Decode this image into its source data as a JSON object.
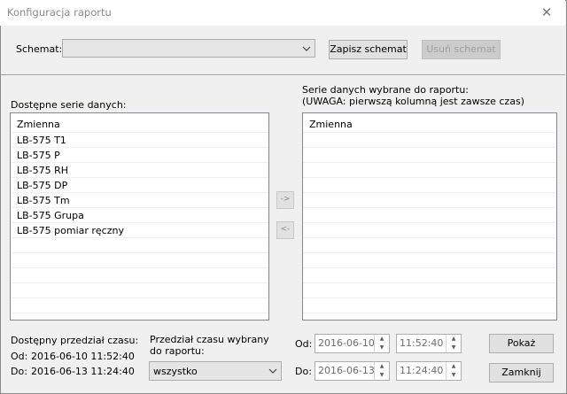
{
  "window": {
    "title": "Konfiguracja raportu"
  },
  "schema": {
    "label": "Schemat:",
    "value": "",
    "save_label": "Zapisz schemat",
    "delete_label": "Usuń schemat"
  },
  "available": {
    "title": "Dostępne serie danych:",
    "header": "Zmienna",
    "items": [
      "LB-575 T1",
      "LB-575 P",
      "LB-575 RH",
      "LB-575 DP",
      "LB-575 Tm",
      "LB-575 Grupa",
      "LB-575 pomiar ręczny"
    ]
  },
  "selected": {
    "title_line1": "Serie danych wybrane do raportu:",
    "title_line2": "(UWAGA: pierwszą kolumną jest zawsze czas)",
    "header": "Zmienna"
  },
  "transfer": {
    "add_label": "->",
    "remove_label": "<-"
  },
  "available_range": {
    "title": "Dostępny przedział czasu:",
    "from_label": "Od:",
    "from_value": "2016-06-10 11:52:40",
    "to_label": "Do:",
    "to_value": "2016-06-13 11:24:40"
  },
  "chosen_range": {
    "title_line1": "Przedział czasu wybrany",
    "title_line2": "do raportu:",
    "select_value": "wszystko",
    "from_label": "Od:",
    "from_date": "2016-06-10",
    "from_time": "11:52:40",
    "to_label": "Do:",
    "to_date": "2016-06-13",
    "to_time": "11:24:40"
  },
  "actions": {
    "show_label": "Pokaż",
    "close_label": "Zamknij"
  }
}
